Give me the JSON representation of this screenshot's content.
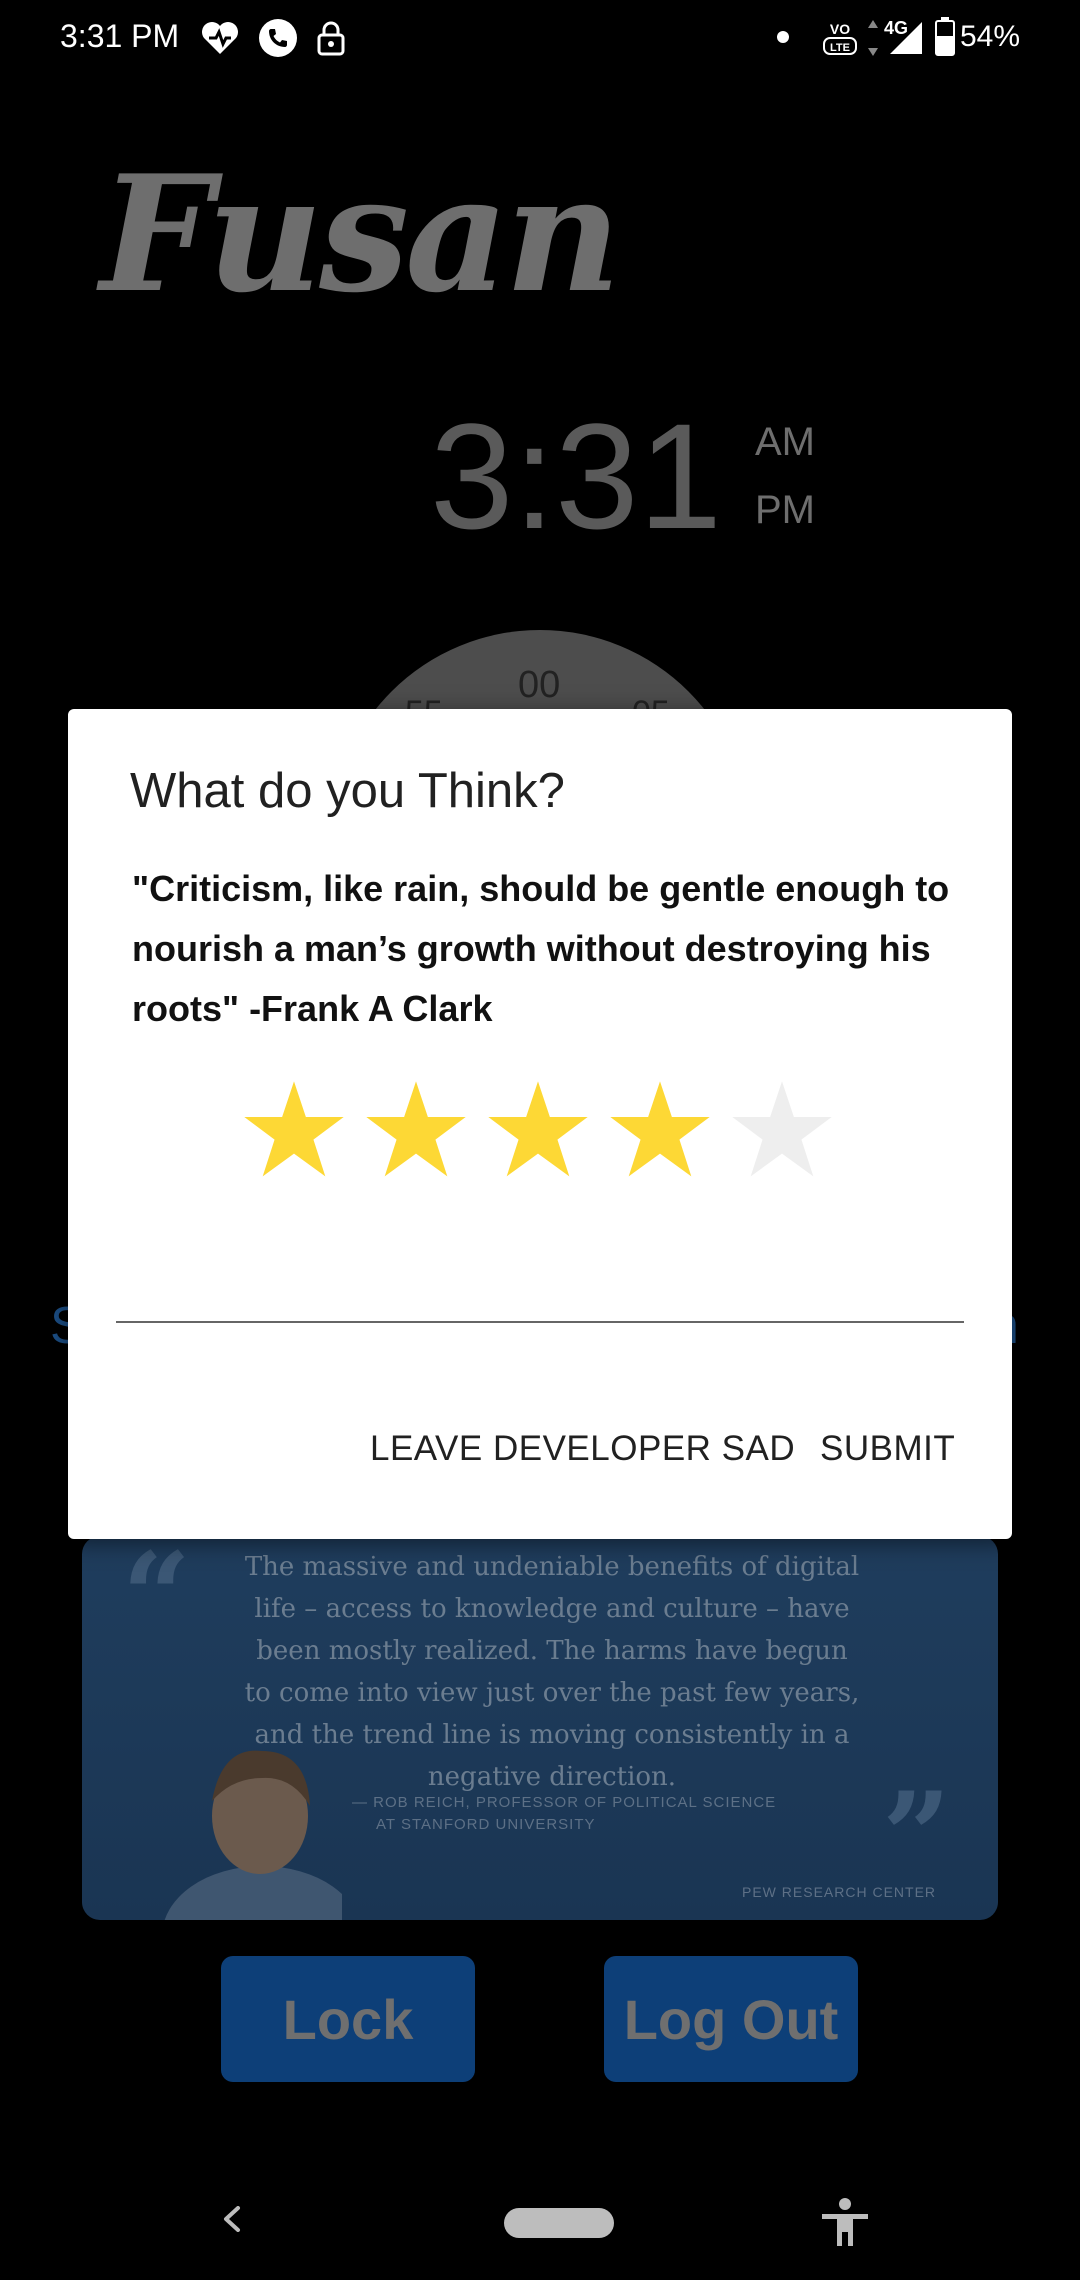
{
  "status_bar": {
    "time": "3:31 PM",
    "battery_percent": "54%",
    "network": "4G",
    "icons": [
      "heart-icon",
      "call-icon",
      "lock-icon",
      "dot-icon",
      "volte-icon",
      "data-arrows-icon",
      "signal-icon",
      "battery-icon"
    ]
  },
  "background_app": {
    "logo": "Fusan",
    "clock": {
      "time": "3:31",
      "am": "AM",
      "pm": "PM"
    },
    "dial": {
      "top": "00",
      "left": "55",
      "right": "05"
    },
    "side_left": "S",
    "side_right": "n",
    "quote_card": {
      "text": "The massive and undeniable benefits of digital life – access to knowledge and culture – have been mostly realized. The harms have begun to come into view just over the past few years, and the trend line is moving consistently in a negative direction.",
      "attribution_line1": "— ROB REICH, PROFESSOR OF POLITICAL SCIENCE",
      "attribution_line2": "AT STANFORD UNIVERSITY",
      "source": "PEW RESEARCH CENTER"
    },
    "lock_button": "Lock",
    "logout_button": "Log Out"
  },
  "dialog": {
    "title": "What do you Think?",
    "quote": "\"Criticism, like rain, should be gentle enough to nourish a man’s growth without destroying his roots\" -Frank A Clark",
    "rating": 4,
    "max_rating": 5,
    "star_filled_color": "#FDD835",
    "star_empty_color": "#EEEEEE",
    "feedback_value": "",
    "feedback_placeholder": "",
    "leave_button": "LEAVE DEVELOPER SAD",
    "submit_button": "SUBMIT"
  },
  "nav_bar": {
    "icons": [
      "back-icon",
      "home-pill-icon",
      "accessibility-icon"
    ]
  }
}
